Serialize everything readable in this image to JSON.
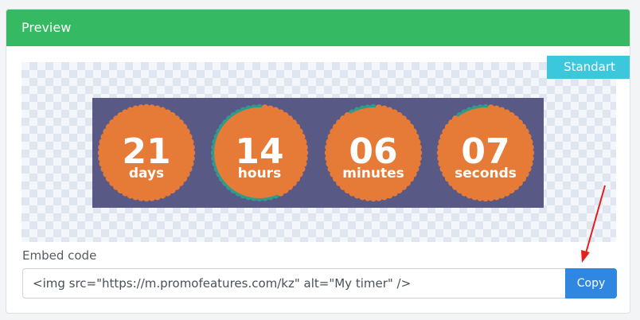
{
  "panel": {
    "title": "Preview"
  },
  "preview": {
    "mode_tag": "Standart"
  },
  "timer": {
    "units": [
      {
        "value": "21",
        "label": "days",
        "progress": 0.0
      },
      {
        "value": "14",
        "label": "hours",
        "progress": 0.58
      },
      {
        "value": "06",
        "label": "minutes",
        "progress": 0.1
      },
      {
        "value": "07",
        "label": "seconds",
        "progress": 0.12
      }
    ],
    "colors": {
      "background": "#595986",
      "circle": "#e67a37",
      "progress_dots": "#2d9c8c",
      "text": "#ffffff"
    }
  },
  "embed": {
    "label": "Embed code",
    "value": "<img src=\"https://m.promofeatures.com/kz\" alt=\"My timer\" />",
    "copy_label": "Copy"
  },
  "colors": {
    "header": "#35b962",
    "tag": "#3cc8dc",
    "button": "#2f87e2",
    "annotation_arrow": "#e32020"
  }
}
